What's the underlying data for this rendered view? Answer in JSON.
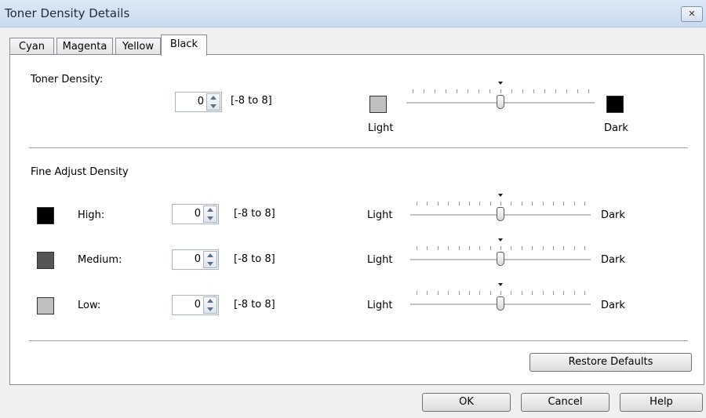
{
  "window": {
    "title": "Toner Density Details",
    "close_icon": "close-icon"
  },
  "tabs": [
    {
      "label": "Cyan"
    },
    {
      "label": "Magenta"
    },
    {
      "label": "Yellow"
    },
    {
      "label": "Black",
      "active": true
    }
  ],
  "toner_density": {
    "label": "Toner Density:",
    "value": "0",
    "range": "[-8 to 8]",
    "light_label": "Light",
    "dark_label": "Dark",
    "slider_value": 0,
    "light_swatch_color": "#c0c0c0",
    "dark_swatch_color": "#000000"
  },
  "fine_adjust": {
    "label": "Fine Adjust Density",
    "rows": [
      {
        "label": "High:",
        "value": "0",
        "range": "[-8 to 8]",
        "light": "Light",
        "dark": "Dark",
        "slider_value": 0,
        "swatch_color": "#000000"
      },
      {
        "label": "Medium:",
        "value": "0",
        "range": "[-8 to 8]",
        "light": "Light",
        "dark": "Dark",
        "slider_value": 0,
        "swatch_color": "#555555"
      },
      {
        "label": "Low:",
        "value": "0",
        "range": "[-8 to 8]",
        "light": "Light",
        "dark": "Dark",
        "slider_value": 0,
        "swatch_color": "#c0c0c0"
      }
    ]
  },
  "buttons": {
    "restore": "Restore Defaults",
    "ok": "OK",
    "cancel": "Cancel",
    "help": "Help"
  },
  "slider_range": {
    "min": -8,
    "max": 8
  }
}
